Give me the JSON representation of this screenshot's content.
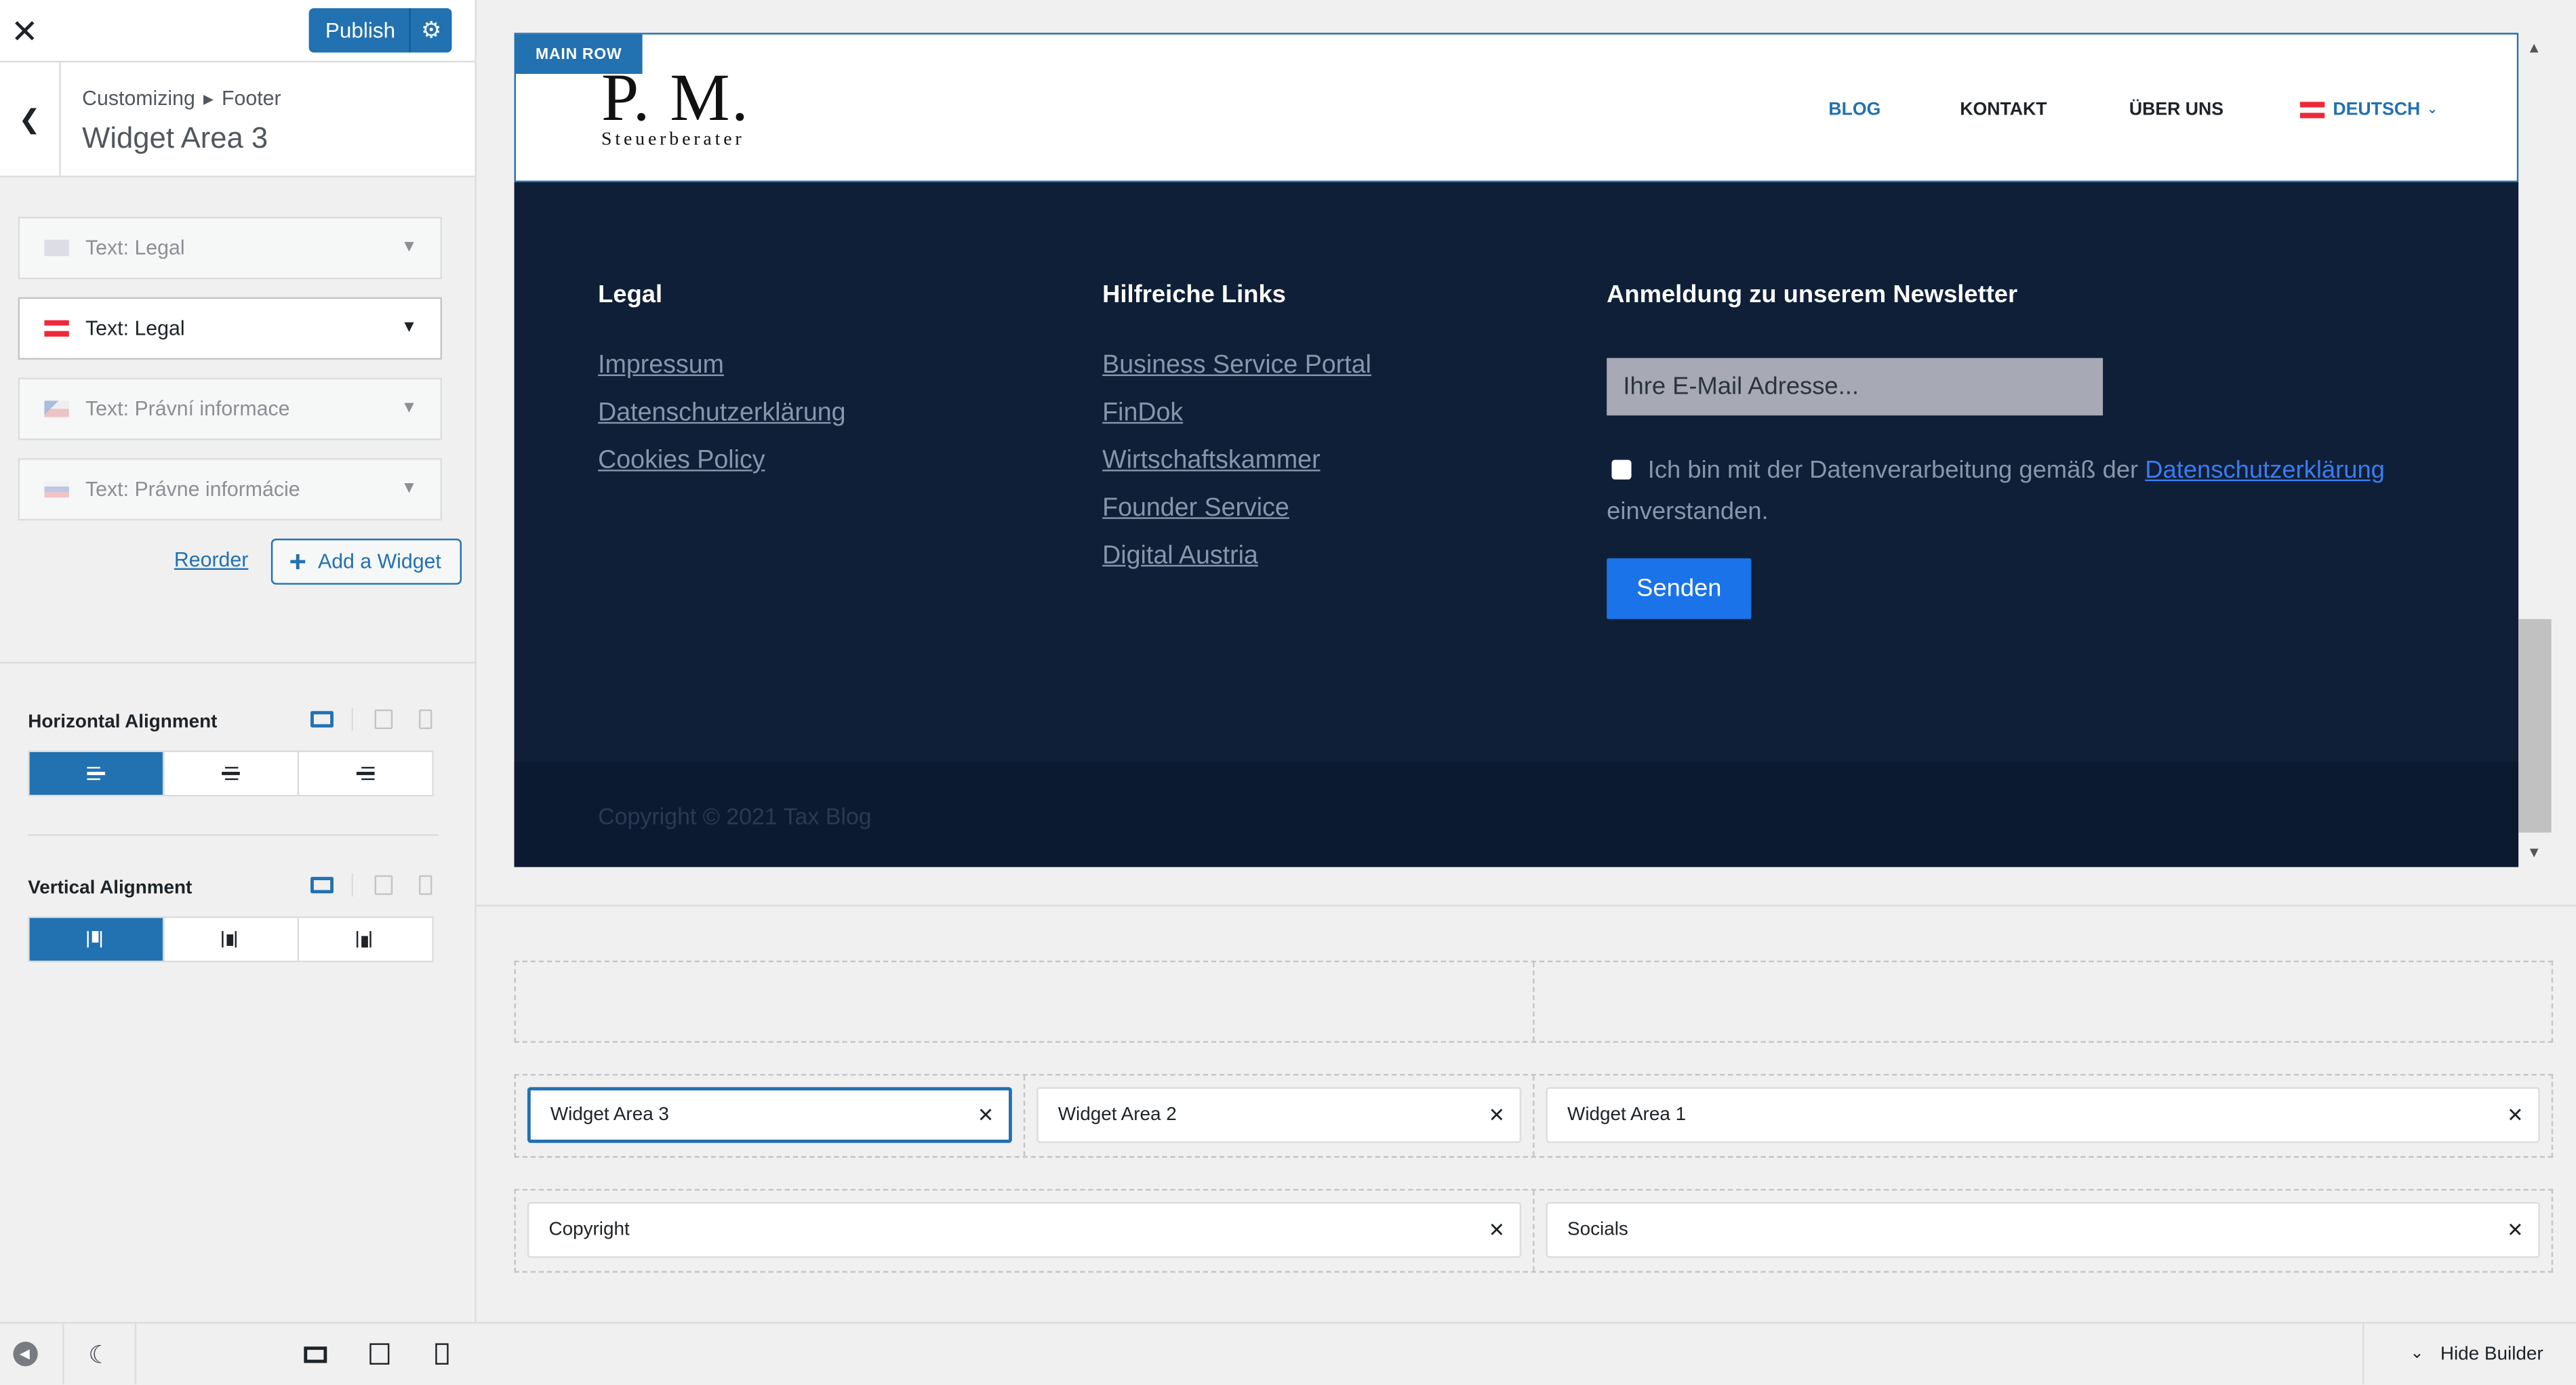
{
  "app": {
    "close_icon": "close-icon",
    "publish_label": "Publish",
    "publish_settings_icon": "gear-icon"
  },
  "sidebar": {
    "breadcrumb": [
      "Customizing",
      "Footer"
    ],
    "title": "Widget Area 3",
    "widgets": [
      {
        "prefix": "Text:",
        "name": "Legal",
        "flag": "uk-flag-icon",
        "active": false
      },
      {
        "prefix": "Text:",
        "name": "Legal",
        "flag": "austria-flag-icon",
        "active": true
      },
      {
        "prefix": "Text:",
        "name": "Právní informace",
        "flag": "czech-flag-icon",
        "active": false
      },
      {
        "prefix": "Text:",
        "name": "Právne informácie",
        "flag": "slovak-flag-icon",
        "active": false
      }
    ],
    "reorder_label": "Reorder",
    "add_widget_label": "Add a Widget",
    "horizontal_alignment": {
      "label": "Horizontal Alignment",
      "options": [
        "left",
        "center",
        "right"
      ],
      "selected": "left"
    },
    "vertical_alignment": {
      "label": "Vertical Alignment",
      "options": [
        "top",
        "middle",
        "bottom"
      ],
      "selected": "top"
    },
    "footer_icons": [
      "collapse-sidebar-icon",
      "dark-mode-icon",
      "desktop-preview-icon",
      "tablet-preview-icon",
      "mobile-preview-icon"
    ]
  },
  "preview": {
    "main_row_tag": "MAIN ROW",
    "logo_big": "P. M.",
    "logo_small": "Steuerberater",
    "nav": [
      "BLOG",
      "KONTAKT",
      "ÜBER UNS"
    ],
    "language": "DEUTSCH",
    "footer": {
      "col1_title": "Legal",
      "col1_links": [
        "Impressum",
        "Datenschutzerklärung",
        "Cookies Policy"
      ],
      "col2_title": "Hilfreiche Links",
      "col2_links": [
        "Business Service Portal",
        "FinDok",
        "Wirtschaftskammer",
        "Founder Service",
        "Digital Austria"
      ],
      "col3_title": "Anmeldung zu unserem Newsletter",
      "email_placeholder": "Ihre E-Mail Adresse...",
      "consent_text": "Ich bin mit der Datenverarbeitung gemäß der",
      "consent_link": "Datenschutzerklärung",
      "consent_text_end": "einverstanden.",
      "submit_label": "Senden",
      "copyright": "Copyright © 2021 Tax Blog"
    },
    "colors": {
      "footer_bg": "#0f1f38",
      "accent": "#2271b1",
      "button": "#1a73e8"
    }
  },
  "builder": {
    "main_row": [
      "Widget Area 3",
      "Widget Area 2",
      "Widget Area 1"
    ],
    "bottom_row": [
      "Copyright",
      "Socials"
    ],
    "selected": "Widget Area 3",
    "hide_builder_label": "Hide Builder"
  }
}
